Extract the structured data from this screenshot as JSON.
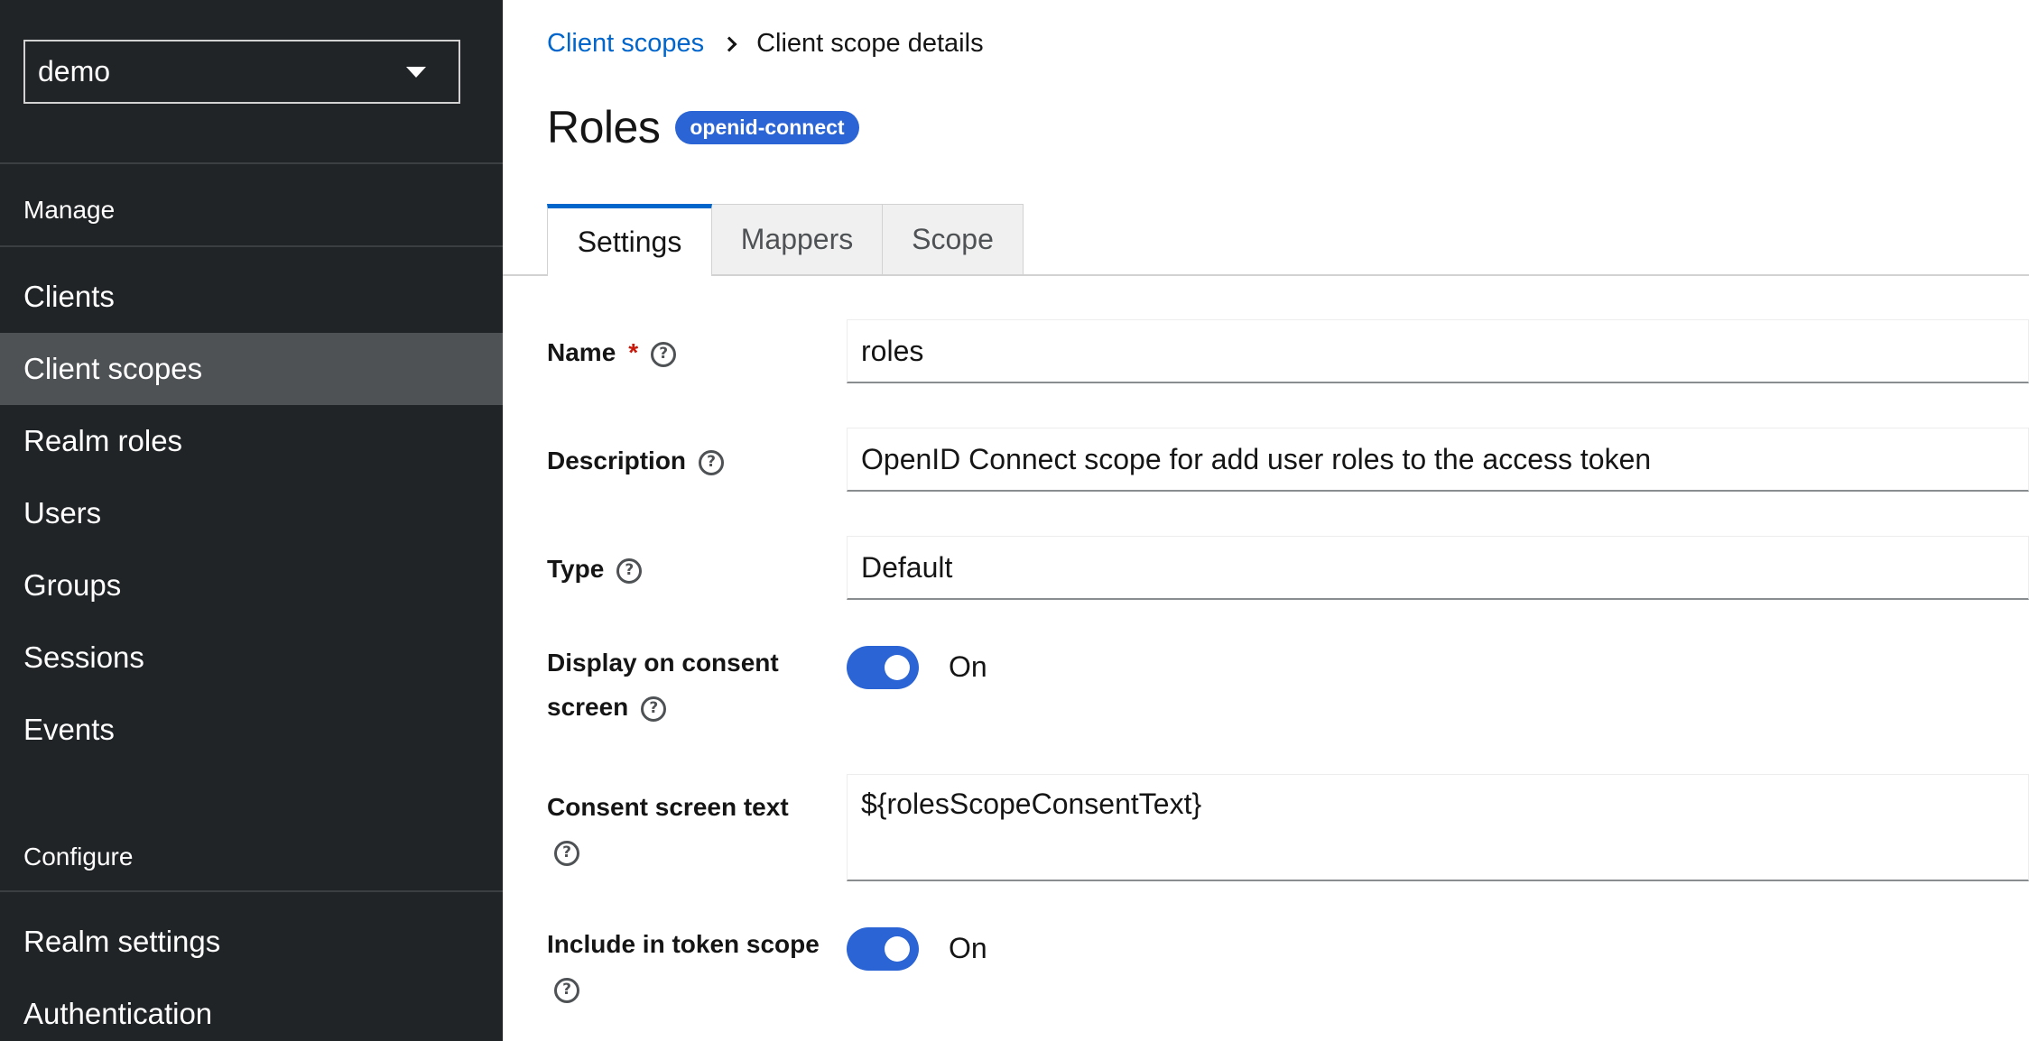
{
  "sidebar": {
    "realm_selector": {
      "value": "demo"
    },
    "sections": [
      {
        "title": "Manage"
      },
      {
        "title": "Configure"
      }
    ],
    "items": [
      {
        "label": "Clients"
      },
      {
        "label": "Client scopes",
        "active": true
      },
      {
        "label": "Realm roles"
      },
      {
        "label": "Users"
      },
      {
        "label": "Groups"
      },
      {
        "label": "Sessions"
      },
      {
        "label": "Events"
      },
      {
        "label": "Realm settings"
      },
      {
        "label": "Authentication"
      }
    ]
  },
  "breadcrumb": {
    "link": "Client scopes",
    "current": "Client scope details"
  },
  "header": {
    "title": "Roles",
    "badge": "openid-connect"
  },
  "tabs": [
    {
      "label": "Settings",
      "active": true
    },
    {
      "label": "Mappers"
    },
    {
      "label": "Scope"
    }
  ],
  "form": {
    "name": {
      "label": "Name",
      "required_mark": "*",
      "value": "roles"
    },
    "description": {
      "label": "Description",
      "value": "OpenID Connect scope for add user roles to the access token"
    },
    "type": {
      "label": "Type",
      "value": "Default"
    },
    "display_on_consent": {
      "label_line1": "Display on consent",
      "label_line2": "screen",
      "state": "On"
    },
    "consent_text": {
      "label": "Consent screen text",
      "value": "${rolesScopeConsentText}"
    },
    "include_in_token_scope": {
      "label": "Include in token scope",
      "state": "On"
    }
  },
  "help_icon_glyph": "?",
  "colors": {
    "sidebar_bg": "#212427",
    "sidebar_active": "#4f5255",
    "link": "#0066cc",
    "accent": "#2b64d4",
    "required": "#c9190b"
  }
}
